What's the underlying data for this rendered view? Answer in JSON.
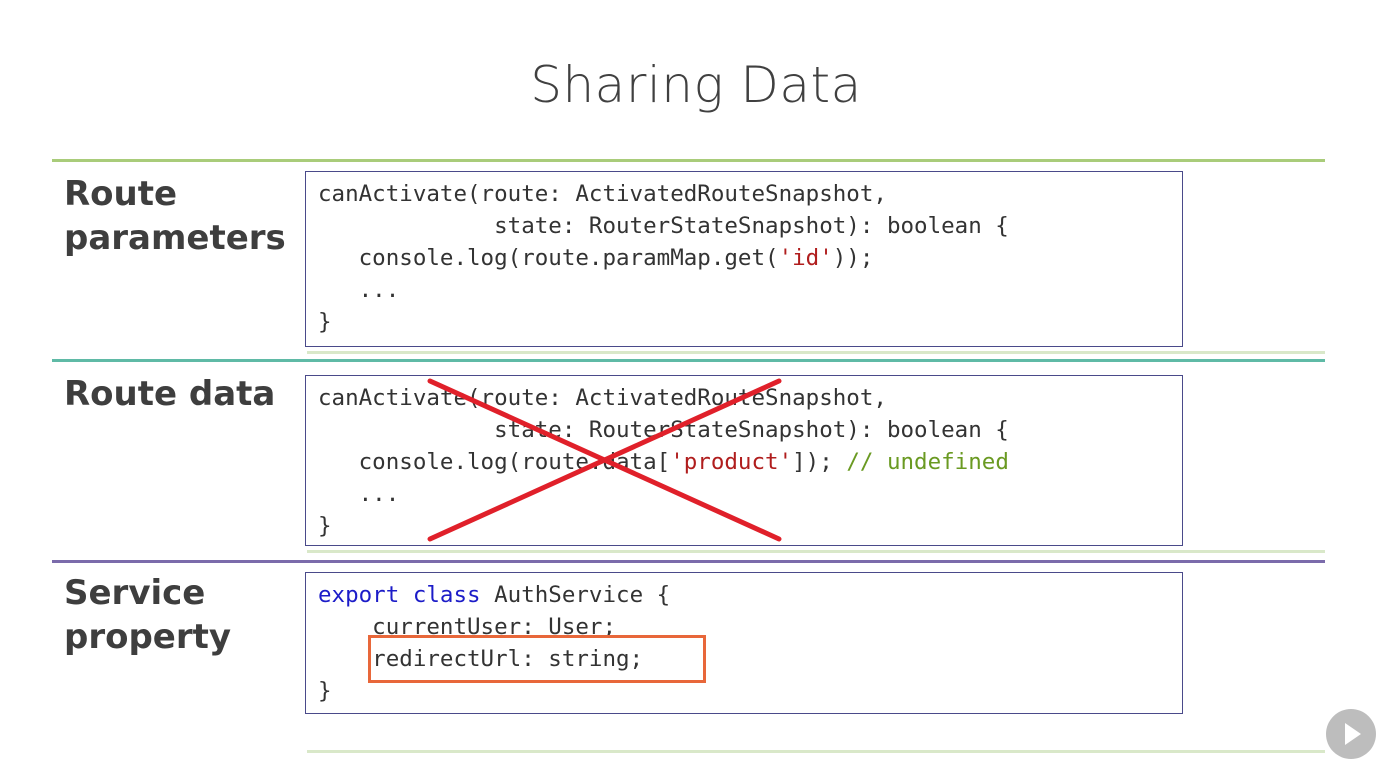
{
  "slide": {
    "title": "Sharing Data"
  },
  "sections": [
    {
      "label_lines": [
        "Route",
        "parameters"
      ],
      "code_lines": [
        [
          {
            "t": "canActivate(route: ActivatedRouteSnapshot,"
          }
        ],
        [
          {
            "t": "             state: RouterStateSnapshot): boolean {"
          }
        ],
        [
          {
            "t": "   console.log(route.paramMap.get("
          },
          {
            "t": "'id'",
            "c": "str"
          },
          {
            "t": "));"
          }
        ],
        [
          {
            "t": "   ..."
          }
        ],
        [
          {
            "t": "}"
          }
        ]
      ]
    },
    {
      "label_lines": [
        "Route data"
      ],
      "code_lines": [
        [
          {
            "t": "canActivate(route: ActivatedRouteSnapshot,"
          }
        ],
        [
          {
            "t": "             state: RouterStateSnapshot): boolean {"
          }
        ],
        [
          {
            "t": "   console.log(route.data["
          },
          {
            "t": "'product'",
            "c": "str"
          },
          {
            "t": "]); "
          },
          {
            "t": "// undefined",
            "c": "cmt"
          }
        ],
        [
          {
            "t": "   ..."
          }
        ],
        [
          {
            "t": "}"
          }
        ]
      ]
    },
    {
      "label_lines": [
        "Service",
        "property"
      ],
      "code_lines": [
        [
          {
            "t": "export",
            "c": "kw"
          },
          {
            "t": " "
          },
          {
            "t": "class",
            "c": "kw"
          },
          {
            "t": " AuthService {"
          }
        ],
        [
          {
            "t": "    currentUser: User;"
          }
        ],
        [
          {
            "t": "    redirectUrl: string;"
          }
        ],
        [
          {
            "t": "}"
          }
        ]
      ]
    }
  ],
  "colors": {
    "rule_green": "#a9cc7a",
    "rule_teal": "#5fbaa6",
    "rule_purple": "#7b6bab",
    "rule_pale": "#d9e8c9",
    "cross_red": "#e0202a",
    "highlight_orange": "#e8673a"
  },
  "player": {
    "icon": "play-icon"
  }
}
